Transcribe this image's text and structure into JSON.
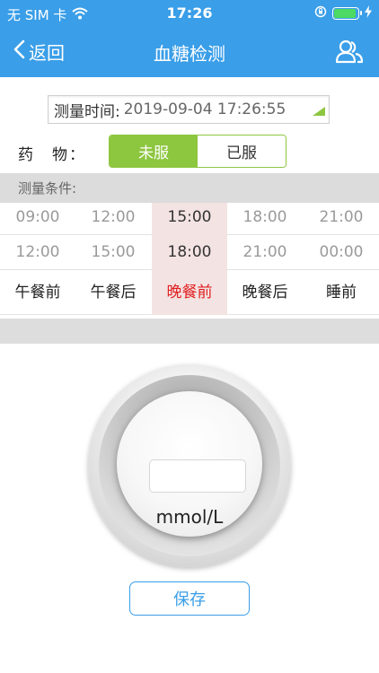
{
  "status_bar": {
    "carrier": "无 SIM 卡",
    "time": "17:26"
  },
  "nav": {
    "back_label": "返回",
    "title": "血糖检测"
  },
  "measure_time": {
    "label": "测量时间:",
    "value": "2019-09-04 17:26:55"
  },
  "medicine": {
    "label": "药　物：",
    "options": [
      "未服",
      "已服"
    ],
    "selected": "未服"
  },
  "conditions": {
    "header": "测量条件:",
    "columns": [
      {
        "start": "09:00",
        "end": "12:00",
        "label": "午餐前"
      },
      {
        "start": "12:00",
        "end": "15:00",
        "label": "午餐后"
      },
      {
        "start": "15:00",
        "end": "18:00",
        "label": "晚餐前"
      },
      {
        "start": "18:00",
        "end": "21:00",
        "label": "晚餐后"
      },
      {
        "start": "21:00",
        "end": "00:00",
        "label": "睡前"
      }
    ],
    "selected_index": 2
  },
  "reading": {
    "value": "",
    "unit": "mmol/L"
  },
  "save_label": "保存",
  "colors": {
    "primary": "#3a9ee8",
    "accent_green": "#8dc63f",
    "selected_text": "#e02020"
  }
}
